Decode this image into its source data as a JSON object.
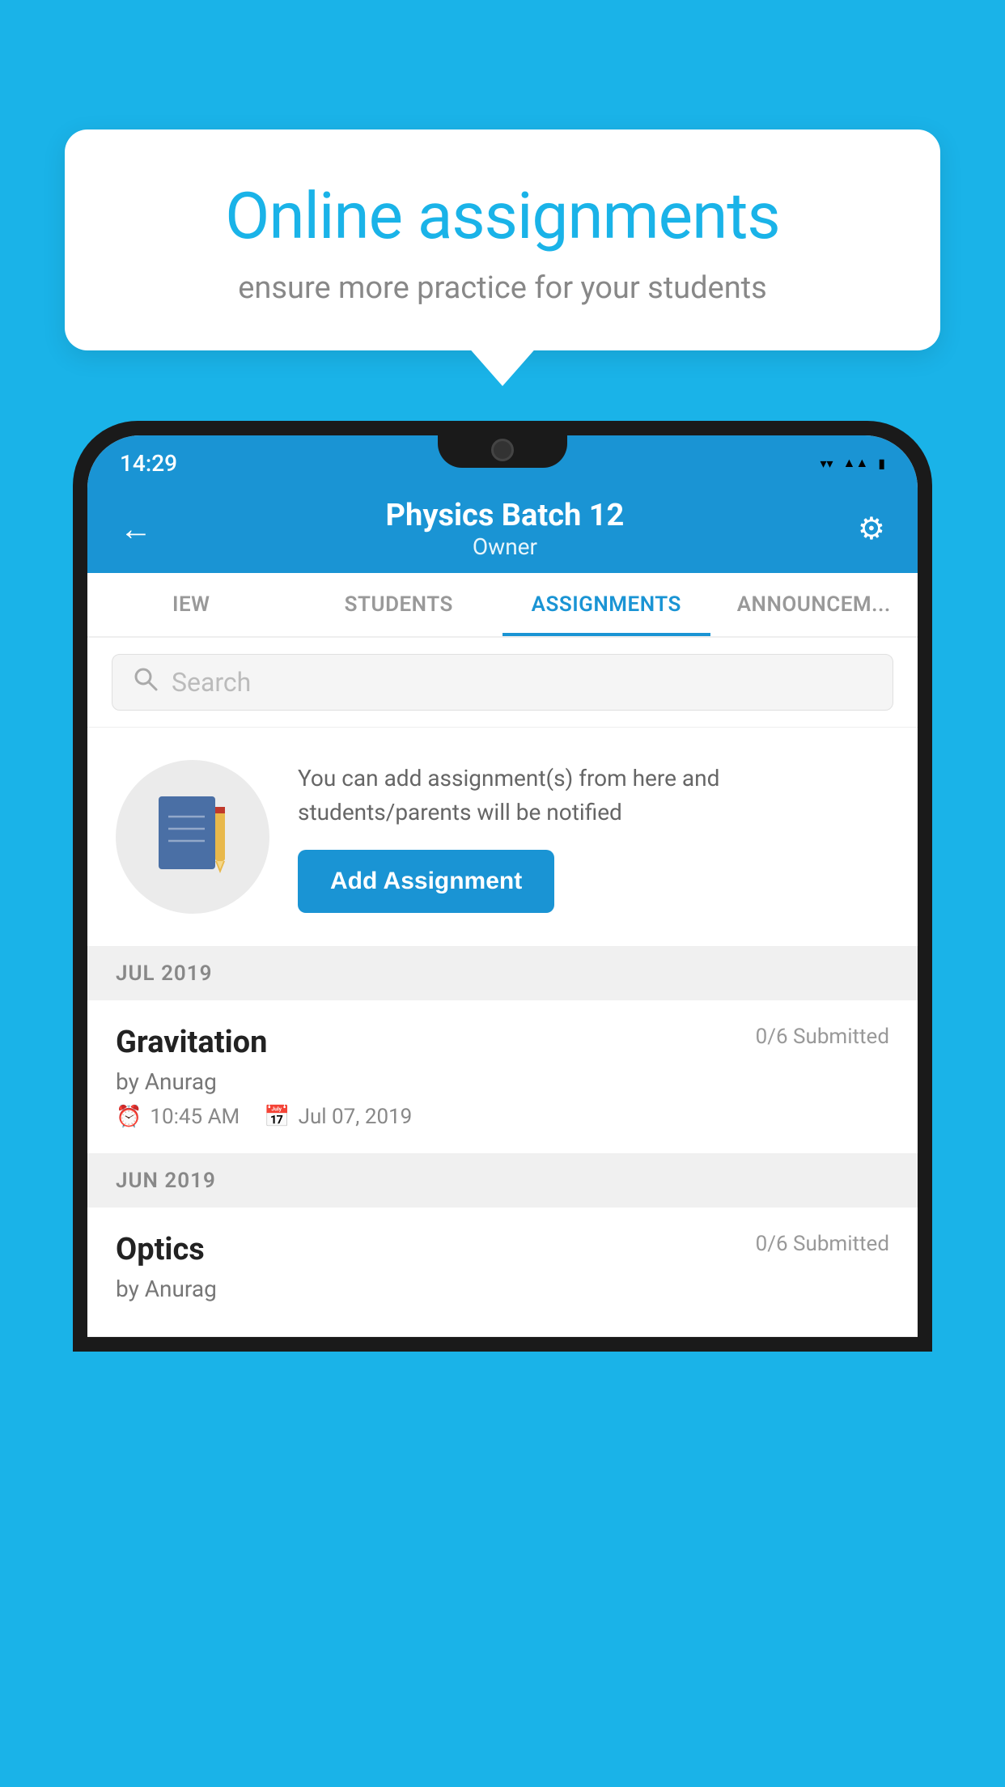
{
  "background_color": "#1ab3e8",
  "tooltip": {
    "title": "Online assignments",
    "subtitle": "ensure more practice for your students"
  },
  "phone": {
    "status_bar": {
      "time": "14:29",
      "icons": [
        "wifi",
        "signal",
        "battery"
      ]
    },
    "header": {
      "title": "Physics Batch 12",
      "subtitle": "Owner",
      "back_label": "←",
      "settings_label": "⚙"
    },
    "tabs": [
      {
        "label": "IEW",
        "active": false
      },
      {
        "label": "STUDENTS",
        "active": false
      },
      {
        "label": "ASSIGNMENTS",
        "active": true
      },
      {
        "label": "ANNOUNCEM...",
        "active": false
      }
    ],
    "search": {
      "placeholder": "Search"
    },
    "promo": {
      "description": "You can add assignment(s) from here and students/parents will be notified",
      "button_label": "Add Assignment"
    },
    "sections": [
      {
        "month": "JUL 2019",
        "assignments": [
          {
            "title": "Gravitation",
            "submitted": "0/6 Submitted",
            "by": "by Anurag",
            "time": "10:45 AM",
            "date": "Jul 07, 2019"
          }
        ]
      },
      {
        "month": "JUN 2019",
        "assignments": [
          {
            "title": "Optics",
            "submitted": "0/6 Submitted",
            "by": "by Anurag",
            "time": "",
            "date": ""
          }
        ]
      }
    ]
  }
}
